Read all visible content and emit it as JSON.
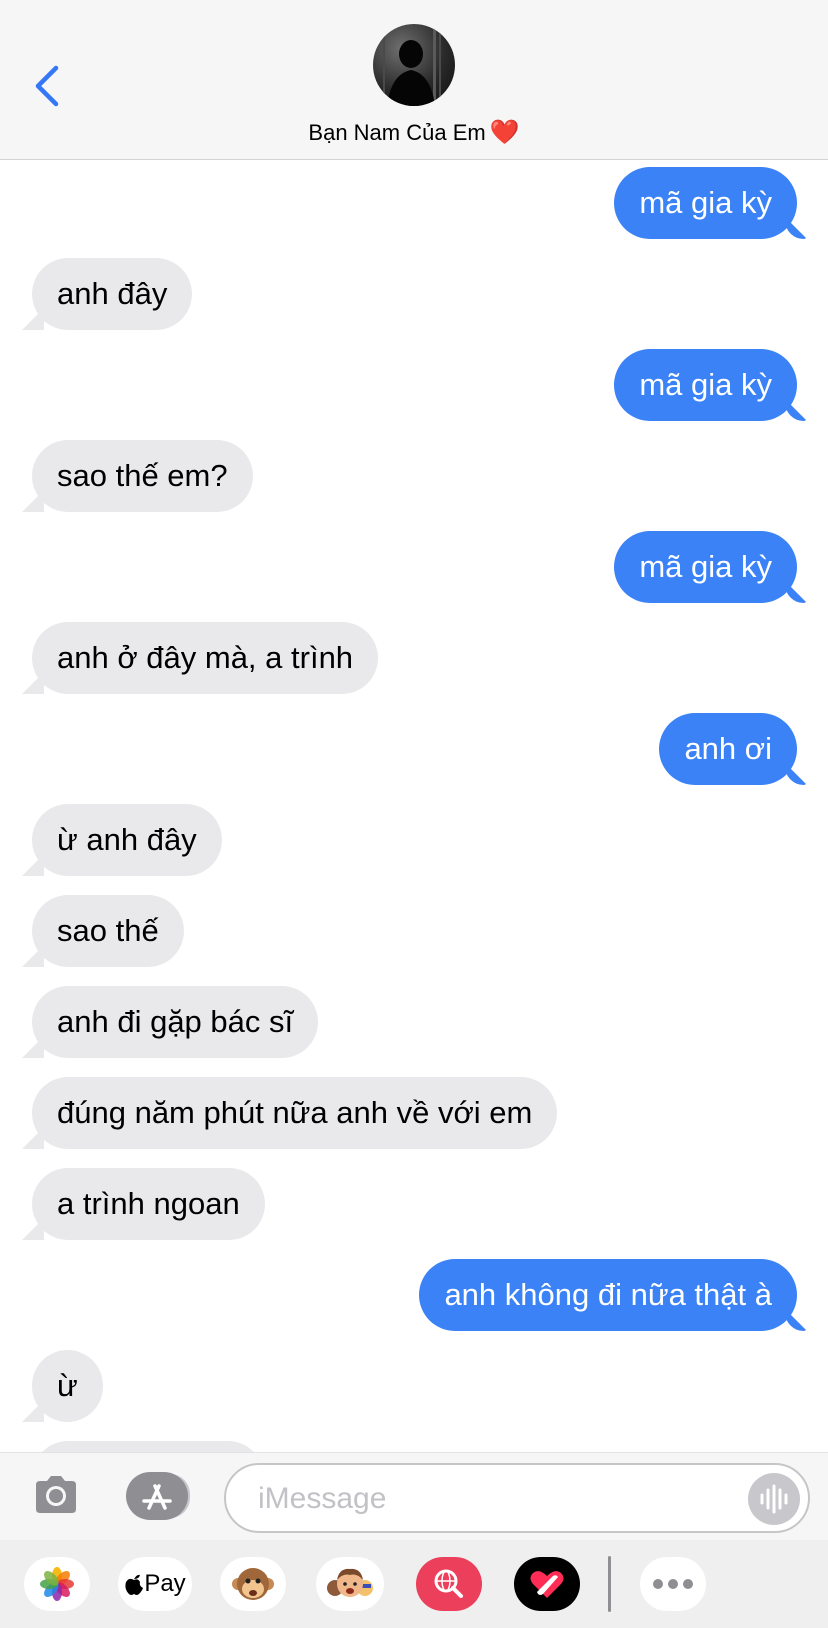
{
  "header": {
    "contact_name": "Bạn Nam Của Em",
    "heart": "❤️"
  },
  "messages": [
    {
      "from": "me",
      "text": "mã gia kỳ"
    },
    {
      "from": "them",
      "text": "anh đây"
    },
    {
      "from": "me",
      "text": "mã gia kỳ"
    },
    {
      "from": "them",
      "text": "sao thế em?"
    },
    {
      "from": "me",
      "text": "mã gia kỳ"
    },
    {
      "from": "them",
      "text": "anh ở đây mà, a trình"
    },
    {
      "from": "me",
      "text": "anh ơi"
    },
    {
      "from": "them",
      "text": "ừ anh đây"
    },
    {
      "from": "them",
      "text": "sao thế"
    },
    {
      "from": "them",
      "text": "anh đi gặp bác sĩ"
    },
    {
      "from": "them",
      "text": "đúng năm phút nữa anh về với em"
    },
    {
      "from": "them",
      "text": "a trình ngoan"
    },
    {
      "from": "me",
      "text": "anh không đi nữa thật à"
    },
    {
      "from": "them",
      "text": "ừ"
    }
  ],
  "input": {
    "placeholder": "iMessage",
    "value": ""
  },
  "app_drawer": {
    "apple_pay_label": "Pay",
    "apps": [
      "photos-icon",
      "apple-pay-icon",
      "animoji-icon",
      "memoji-icon",
      "web-search-icon",
      "digital-touch-icon",
      "more-icon"
    ]
  },
  "colors": {
    "sent_bubble": "#3a82f6",
    "received_bubble": "#e9e9eb",
    "accent": "#3478f6"
  }
}
